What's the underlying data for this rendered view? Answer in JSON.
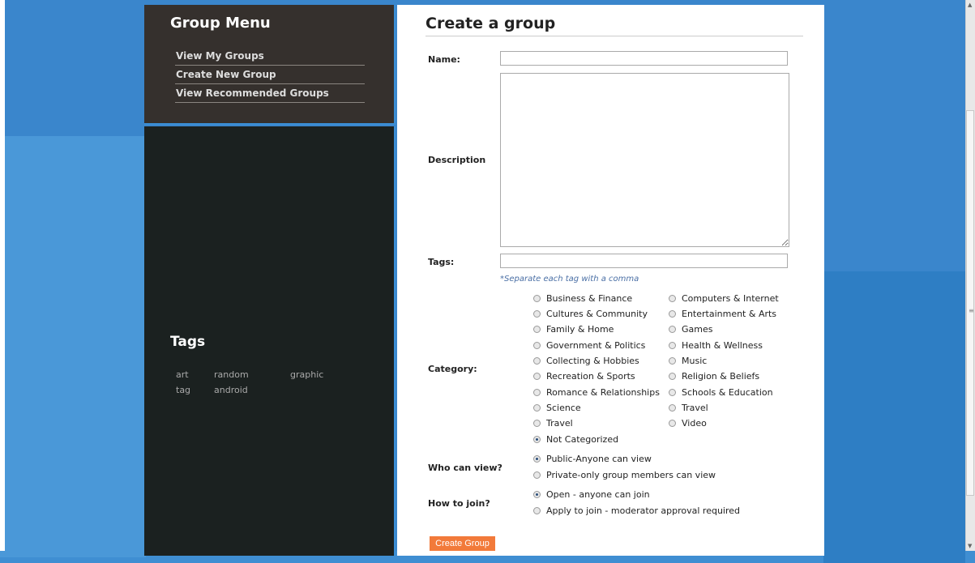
{
  "sidebar": {
    "menu_title": "Group Menu",
    "menu_items": [
      "View My Groups",
      "Create New Group",
      "View Recommended Groups"
    ],
    "tags_title": "Tags",
    "tags": [
      "art",
      "random",
      "graphic",
      "tag",
      "android"
    ]
  },
  "form": {
    "title": "Create a group",
    "name_label": "Name:",
    "name_value": "",
    "description_label": "Description",
    "description_value": "",
    "tags_label": "Tags:",
    "tags_value": "",
    "tags_hint": "*Separate each tag with a comma",
    "category_label": "Category:",
    "categories_left": [
      "Business & Finance",
      "Cultures & Community",
      "Family & Home",
      "Government & Politics",
      "Collecting & Hobbies",
      "Recreation & Sports",
      "Romance & Relationships",
      "Science",
      "Travel",
      "Not Categorized"
    ],
    "categories_right": [
      "Computers & Internet",
      "Entertainment & Arts",
      "Games",
      "Health & Wellness",
      "Music",
      "Religion & Beliefs",
      "Schools & Education",
      "Travel",
      "Video"
    ],
    "category_selected": "Not Categorized",
    "view_label": "Who can view?",
    "view_options": [
      "Public-Anyone can view",
      "Private-only group members can view"
    ],
    "view_selected": "Public-Anyone can view",
    "join_label": "How to join?",
    "join_options": [
      "Open - anyone can join",
      "Apply to join - moderator approval required"
    ],
    "join_selected": "Open - anyone can join",
    "submit_label": "Create Group"
  },
  "colors": {
    "background": "#3a86cc",
    "sidebar_menu_bg": "#35302d",
    "sidebar_tags_bg": "#1b2120",
    "button": "#f27a3a",
    "hint": "#4a6fa5"
  }
}
